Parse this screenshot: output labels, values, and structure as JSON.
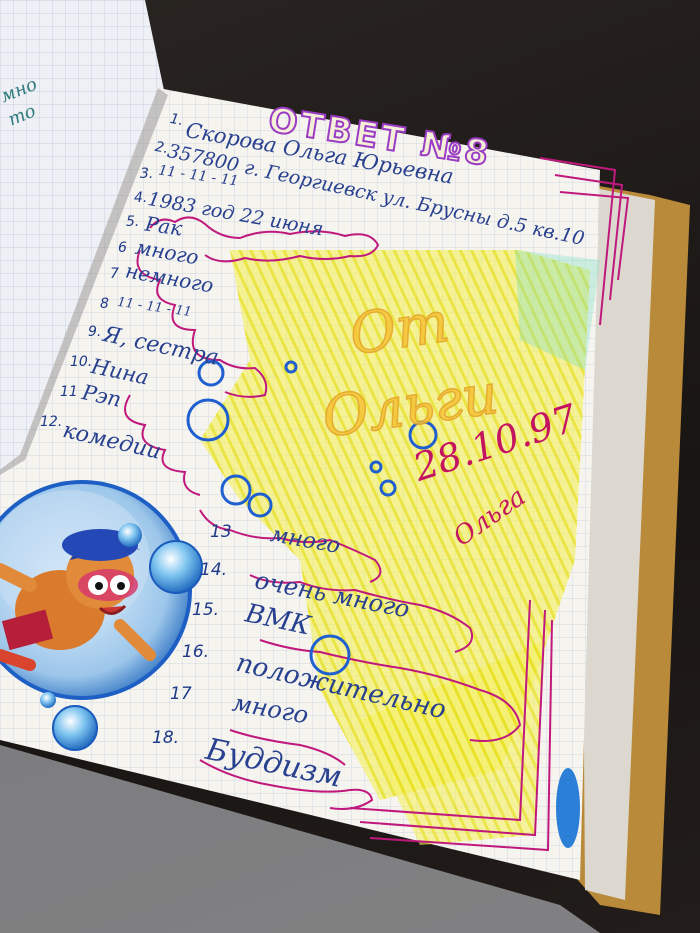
{
  "title": "ОТВЕТ №8",
  "answers": [
    {
      "n": "1.",
      "text": "Скорова Ольга Юрьевна"
    },
    {
      "n": "2.",
      "text": "357800 г. Георгиевск ул. Брусны д.5 кв.10"
    },
    {
      "n": "3.",
      "text": "11 - 11 - 11"
    },
    {
      "n": "4.",
      "text": "1983 год 22 июня"
    },
    {
      "n": "5.",
      "text": "Рак"
    },
    {
      "n": "6",
      "text": "много"
    },
    {
      "n": "7",
      "text": "немного"
    },
    {
      "n": "8",
      "text": "11 - 11 - 11"
    },
    {
      "n": "9.",
      "text": "Я, сестра"
    },
    {
      "n": "10.",
      "text": "Нина"
    },
    {
      "n": "11",
      "text": "Рэп"
    },
    {
      "n": "12.",
      "text": "комедии"
    },
    {
      "n": "13",
      "text": "много"
    },
    {
      "n": "14.",
      "text": "очень много"
    },
    {
      "n": "15.",
      "text": "ВМК"
    },
    {
      "n": "16.",
      "text": "положительно"
    },
    {
      "n": "17",
      "text": "много"
    },
    {
      "n": "18.",
      "text": "Буддизм"
    }
  ],
  "signature_big": "От Ольги",
  "date": "28.10.97",
  "autograph": "Ольга",
  "left_page_fragment": [
    "мно",
    "то"
  ],
  "colors": {
    "ink": "#27408f",
    "highlight": "#f2ef3a",
    "pink": "#c0197d",
    "date": "#c41361"
  }
}
